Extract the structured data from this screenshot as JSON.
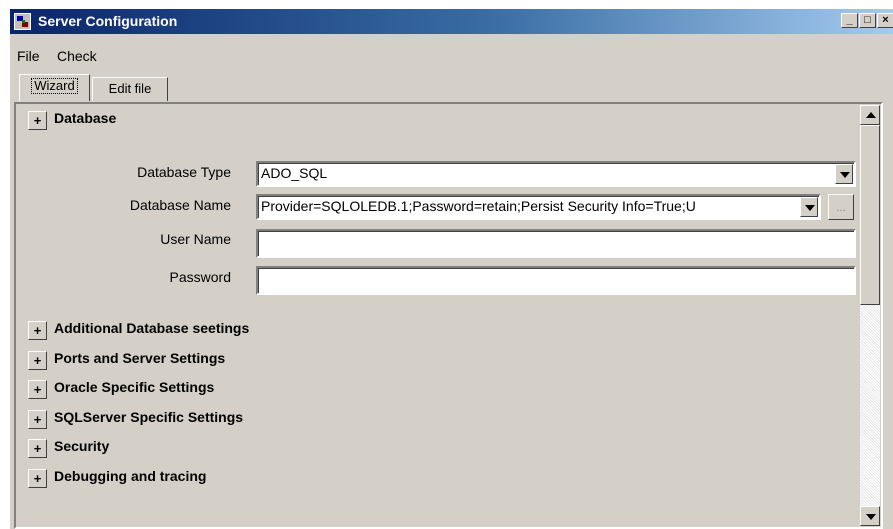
{
  "window": {
    "title": "Server Configuration"
  },
  "menu": {
    "file": "File",
    "check": "Check"
  },
  "tabs": [
    {
      "label": "Wizard"
    },
    {
      "label": "Edit file"
    }
  ],
  "database_section": {
    "title": "Database",
    "expand_glyph": "+",
    "fields": {
      "db_type_label": "Database Type",
      "db_type_value": "ADO_SQL",
      "db_name_label": "Database Name",
      "db_name_value": "Provider=SQLOLEDB.1;Password=retain;Persist Security Info=True;U",
      "user_label": "User Name",
      "user_value": "",
      "password_label": "Password",
      "password_value": ""
    },
    "ellipsis": "..."
  },
  "sections": [
    {
      "title": "Additional Database seetings",
      "glyph": "+"
    },
    {
      "title": "Ports and Server Settings",
      "glyph": "+"
    },
    {
      "title": "Oracle Specific Settings",
      "glyph": "+"
    },
    {
      "title": "SQLServer Specific Settings",
      "glyph": "+"
    },
    {
      "title": "Security",
      "glyph": "+"
    },
    {
      "title": "Debugging and tracing",
      "glyph": "+"
    }
  ],
  "caption_buttons": {
    "minimize": "_",
    "maximize": "□",
    "close": "×"
  }
}
